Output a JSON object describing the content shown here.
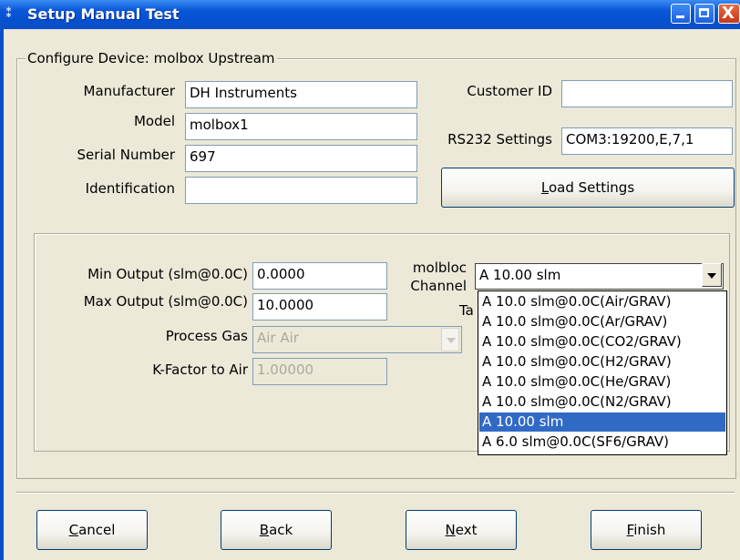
{
  "window": {
    "title": "Setup Manual Test",
    "app_icon": "molbox-app-icon",
    "controls": {
      "minimize_icon": "minimize-icon",
      "maximize_icon": "maximize-icon",
      "close_icon": "close-icon",
      "close_glyph": "X"
    }
  },
  "device_group": {
    "legend": "Configure Device: molbox Upstream",
    "manufacturer": {
      "label": "Manufacturer",
      "value": "DH Instruments"
    },
    "model": {
      "label": "Model",
      "value": "molbox1"
    },
    "serial_number": {
      "label": "Serial Number",
      "value": "697"
    },
    "identification": {
      "label": "Identification",
      "value": ""
    },
    "customer_id": {
      "label": "Customer ID",
      "value": ""
    },
    "rs232": {
      "label": "RS232 Settings",
      "value": "COM3:19200,E,7,1"
    },
    "load_settings": {
      "label_pre": "",
      "mnemonic": "L",
      "label_post": "oad Settings"
    }
  },
  "output_group": {
    "min_output": {
      "label": "Min Output (slm@0.0C)",
      "value": "0.0000"
    },
    "max_output": {
      "label": "Max Output (slm@0.0C)",
      "value": "10.0000"
    },
    "process_gas": {
      "label": "Process Gas",
      "value": "Air Air"
    },
    "k_factor": {
      "label": "K-Factor to Air",
      "value": "1.00000"
    },
    "molbloc_channel": {
      "label_line1": "molbloc",
      "label_line2": "Channel",
      "selected": "A 10.00 slm",
      "obscured_label_fragment": "Ta",
      "options": [
        "A 10.0 slm@0.0C(Air/GRAV)",
        "A 10.0 slm@0.0C(Ar/GRAV)",
        "A 10.0 slm@0.0C(CO2/GRAV)",
        "A 10.0 slm@0.0C(H2/GRAV)",
        "A 10.0 slm@0.0C(He/GRAV)",
        "A 10.0 slm@0.0C(N2/GRAV)",
        "A 10.00 slm",
        "A 6.0 slm@0.0C(SF6/GRAV)"
      ],
      "highlighted_index": 6
    }
  },
  "footer": {
    "cancel": {
      "mnemonic": "C",
      "rest": "ancel"
    },
    "back": {
      "mnemonic": "B",
      "rest": "ack"
    },
    "next": {
      "mnemonic": "N",
      "rest": "ext"
    },
    "finish": {
      "mnemonic": "F",
      "rest": "inish"
    }
  }
}
